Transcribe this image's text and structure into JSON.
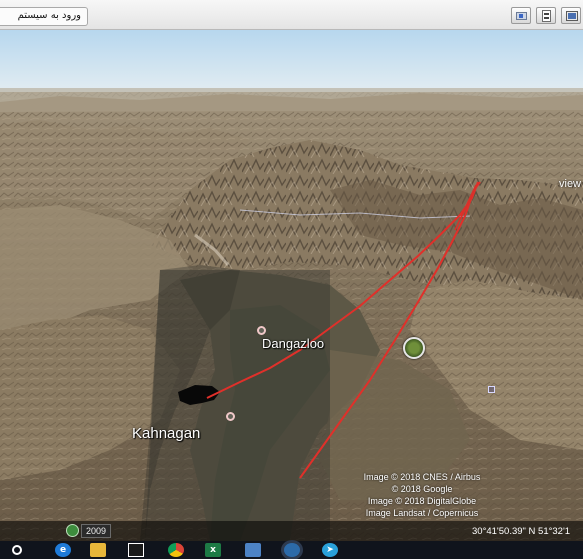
{
  "toolbar": {
    "signin_label": "ورود به سیستم",
    "icons": [
      "image-icon",
      "save-icon",
      "print-icon"
    ]
  },
  "map": {
    "places": [
      {
        "name": "Dangazloo"
      },
      {
        "name": "Kahnagan"
      }
    ],
    "view_label": "view",
    "attribution": [
      "Image © 2018 CNES / Airbus",
      "© 2018 Google",
      "Image © 2018 DigitalGlobe",
      "Image Landsat / Copernicus"
    ],
    "path_color": "#e0302a"
  },
  "statusbar": {
    "imagery_year": "2009",
    "coordinates": "30°41'50.39\" N  51°32'1"
  },
  "taskbar": {
    "apps": [
      "search-icon",
      "edge-icon",
      "file-explorer-icon",
      "store-icon",
      "chrome-icon",
      "excel-icon",
      "app-icon",
      "google-earth-icon",
      "telegram-icon"
    ]
  }
}
